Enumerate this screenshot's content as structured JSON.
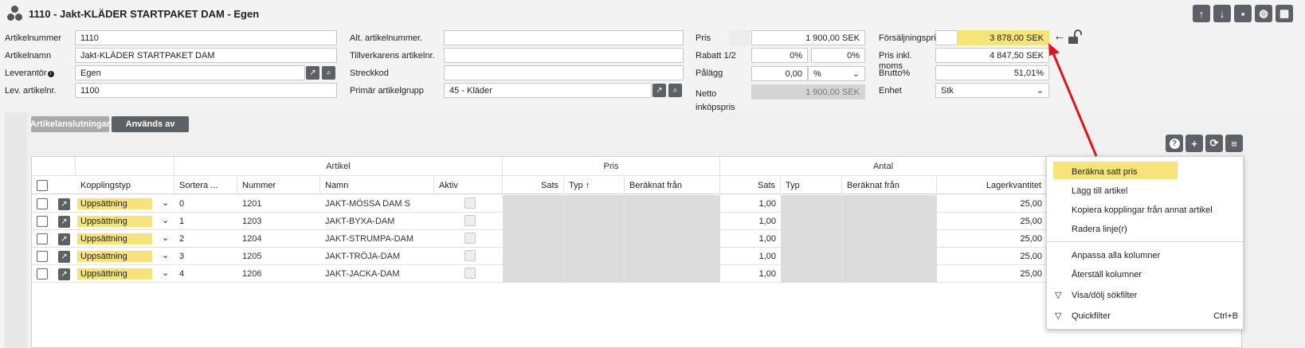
{
  "header": {
    "title": "1110 - Jakt-KLÄDER STARTPAKET DAM - Egen",
    "actions": [
      "arrow-up-icon",
      "arrow-down-icon",
      "save-icon",
      "globe-icon",
      "grid-icon"
    ]
  },
  "form": {
    "artikelnummer_label": "Artikelnummer",
    "artikelnummer": "1110",
    "artikelnamn_label": "Artikelnamn",
    "artikelnamn": "Jakt-KLÄDER STARTPAKET DAM",
    "leverantor_label": "Leverantör",
    "leverantor": "Egen",
    "lev_artikelnr_label": "Lev. artikelnr.",
    "lev_artikelnr": "1100",
    "alt_artikelnummer_label": "Alt. artikelnummer.",
    "alt_artikelnummer": "",
    "tillverkarens_label": "Tillverkarens artikelnr.",
    "tillverkarens": "",
    "streckkod_label": "Streckkod",
    "streckkod": "",
    "primar_label": "Primär artikelgrupp",
    "primar": "45 - Kläder",
    "pris_label": "Pris",
    "pris": "1 900,00 SEK",
    "rabatt_label": "Rabatt 1/2",
    "rabatt1": "0%",
    "rabatt2": "0%",
    "palagg_label": "Pålägg",
    "palagg": "0,00",
    "palagg_unit": "%",
    "netto_label": "Netto inköpspris",
    "netto": "1 900,00 SEK",
    "forsaljningspris_label": "Försäljningspris",
    "forsaljningspris": "3 878,00 SEK",
    "pris_inkl_label": "Pris inkl. moms",
    "pris_inkl": "4 847,50 SEK",
    "brutto_label": "Brutto%",
    "brutto": "51,01%",
    "enhet_label": "Enhet",
    "enhet": "Stk"
  },
  "tabs": {
    "artikelanslutningar": "Artikelanslutningar",
    "anvands_av": "Används av"
  },
  "grid": {
    "groups": {
      "artikel": "Artikel",
      "pris": "Pris",
      "antal": "Antal"
    },
    "columns": {
      "kopplingstyp": "Kopplingstyp",
      "sortera": "Sortera ...",
      "nummer": "Nummer",
      "namn": "Namn",
      "aktiv": "Aktiv",
      "pris_sats": "Sats",
      "pris_typ": "Typ",
      "pris_beraknat": "Beräknat från",
      "antal_sats": "Sats",
      "antal_typ": "Typ",
      "antal_beraknat": "Beräknat från",
      "lagerkvantitet": "Lagerkvantitet"
    },
    "rows": [
      {
        "typ": "Uppsättning",
        "sort": "0",
        "nummer": "1201",
        "namn": "JAKT-MÖSSA DAM S",
        "sats": "1,00",
        "lager": "25,00"
      },
      {
        "typ": "Uppsättning",
        "sort": "1",
        "nummer": "1203",
        "namn": "JAKT-BYXA-DAM",
        "sats": "1,00",
        "lager": "25,00"
      },
      {
        "typ": "Uppsättning",
        "sort": "2",
        "nummer": "1204",
        "namn": "JAKT-STRUMPA-DAM",
        "sats": "1,00",
        "lager": "25,00"
      },
      {
        "typ": "Uppsättning",
        "sort": "3",
        "nummer": "1205",
        "namn": "JAKT-TRÖJA-DAM",
        "sats": "1,00",
        "lager": "25,00"
      },
      {
        "typ": "Uppsättning",
        "sort": "4",
        "nummer": "1206",
        "namn": "JAKT-JACKA-DAM",
        "sats": "1,00",
        "lager": "25,00"
      }
    ]
  },
  "menu": {
    "berakna": "Beräkna satt pris",
    "lagg_till": "Lägg till artikel",
    "kopiera": "Kopiera kopplingar från annat artikel",
    "radera": "Radera linje(r)",
    "anpassa": "Anpassa alla kolumner",
    "aterstall": "Återställ kolumner",
    "visa_dolj": "Visa/dölj sökfilter",
    "quickfilter": "Quickfilter",
    "quickfilter_shortcut": "Ctrl+B"
  },
  "colors": {
    "highlight": "#f6e37a",
    "arrow": "#e0141e",
    "button": "#5d6166"
  }
}
